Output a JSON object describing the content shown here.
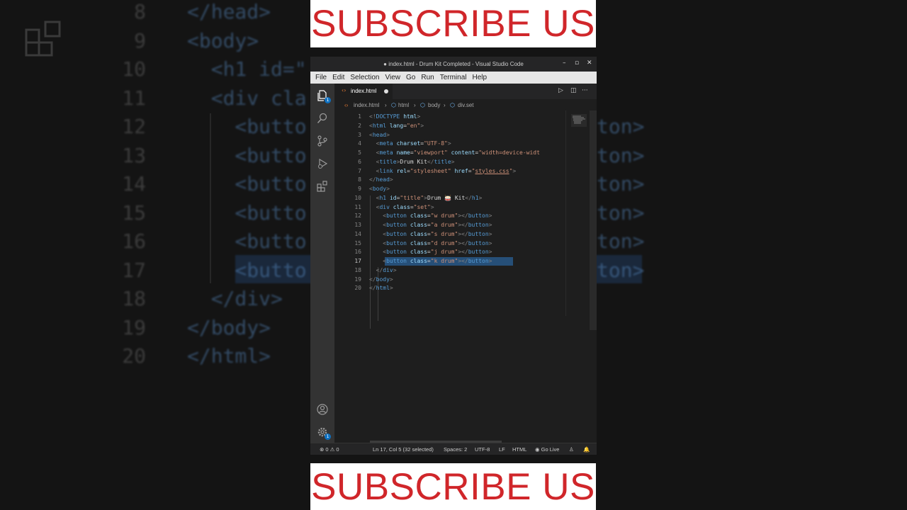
{
  "banner": {
    "top": "SUBSCRIBE US",
    "bottom": "SUBSCRIBE US",
    "text_color": "#d0262a",
    "bg_color": "#ffffff"
  },
  "window": {
    "title": "● index.html - Drum Kit Completed - Visual Studio Code",
    "controls": {
      "minimize": "–",
      "maximize": "▫",
      "close": "✕"
    }
  },
  "menu": [
    "File",
    "Edit",
    "Selection",
    "View",
    "Go",
    "Run",
    "Terminal",
    "Help"
  ],
  "activity_bar": {
    "icons": [
      "explorer-icon",
      "search-icon",
      "source-control-icon",
      "run-debug-icon",
      "extensions-icon",
      "account-icon",
      "settings-gear-icon"
    ],
    "explorer_badge": "1",
    "settings_badge": "1"
  },
  "tab": {
    "label": "index.html",
    "icon": "‹›",
    "modified": true
  },
  "tab_tools": {
    "run": "▷",
    "split": "◫",
    "more": "···"
  },
  "breadcrumb": [
    "index.html",
    "html",
    "body",
    "div.set"
  ],
  "editor": {
    "current_line": 17,
    "lines": [
      {
        "n": "1",
        "html": "<span class='pn'>&lt;!</span><span class='tg'>DOCTYPE</span> <span class='at'>html</span><span class='pn'>&gt;</span>"
      },
      {
        "n": "2",
        "html": "<span class='pn'>&lt;</span><span class='tg'>html</span> <span class='at'>lang</span>=<span class='st'>\"en\"</span><span class='pn'>&gt;</span>"
      },
      {
        "n": "3",
        "html": "<span class='pn'>&lt;</span><span class='tg'>head</span><span class='pn'>&gt;</span>"
      },
      {
        "n": "4",
        "html": "  <span class='pn'>&lt;</span><span class='tg'>meta</span> <span class='at'>charset</span>=<span class='st'>\"UTF-8\"</span><span class='pn'>&gt;</span>"
      },
      {
        "n": "5",
        "html": "  <span class='pn'>&lt;</span><span class='tg'>meta</span> <span class='at'>name</span>=<span class='st'>\"viewport\"</span> <span class='at'>content</span>=<span class='st'>\"width=device-widt</span>"
      },
      {
        "n": "6",
        "html": "  <span class='pn'>&lt;</span><span class='tg'>title</span><span class='pn'>&gt;</span>Drum Kit<span class='pn'>&lt;/</span><span class='tg'>title</span><span class='pn'>&gt;</span>"
      },
      {
        "n": "7",
        "html": "  <span class='pn'>&lt;</span><span class='tg'>link</span> <span class='at'>rel</span>=<span class='st'>\"stylesheet\"</span> <span class='at'>href</span>=<span class='st'>\"</span><span class='lk'>styles.css</span><span class='st'>\"</span><span class='pn'>&gt;</span>"
      },
      {
        "n": "8",
        "html": "<span class='pn'>&lt;/</span><span class='tg'>head</span><span class='pn'>&gt;</span>"
      },
      {
        "n": "9",
        "html": "<span class='pn'>&lt;</span><span class='tg'>body</span><span class='pn'>&gt;</span>"
      },
      {
        "n": "10",
        "html": "  <span class='pn'>&lt;</span><span class='tg'>h1</span> <span class='at'>id</span>=<span class='st'>\"title\"</span><span class='pn'>&gt;</span>Drum 🥁 Kit<span class='pn'>&lt;/</span><span class='tg'>h1</span><span class='pn'>&gt;</span>"
      },
      {
        "n": "11",
        "html": "  <span class='pn'>&lt;</span><span class='tg'>div</span> <span class='at'>class</span>=<span class='st'>\"set\"</span><span class='pn'>&gt;</span>"
      },
      {
        "n": "12",
        "html": "    <span class='pn'>&lt;</span><span class='tg'>button</span> <span class='at'>class</span>=<span class='st'>\"w drum\"</span><span class='pn'>&gt;&lt;/</span><span class='tg'>button</span><span class='pn'>&gt;</span>"
      },
      {
        "n": "13",
        "html": "    <span class='pn'>&lt;</span><span class='tg'>button</span> <span class='at'>class</span>=<span class='st'>\"a drum\"</span><span class='pn'>&gt;&lt;/</span><span class='tg'>button</span><span class='pn'>&gt;</span>"
      },
      {
        "n": "14",
        "html": "    <span class='pn'>&lt;</span><span class='tg'>button</span> <span class='at'>class</span>=<span class='st'>\"s drum\"</span><span class='pn'>&gt;&lt;/</span><span class='tg'>button</span><span class='pn'>&gt;</span>"
      },
      {
        "n": "15",
        "html": "    <span class='pn'>&lt;</span><span class='tg'>button</span> <span class='at'>class</span>=<span class='st'>\"d drum\"</span><span class='pn'>&gt;&lt;/</span><span class='tg'>button</span><span class='pn'>&gt;</span>"
      },
      {
        "n": "16",
        "html": "    <span class='pn'>&lt;</span><span class='tg'>button</span> <span class='at'>class</span>=<span class='st'>\"j drum\"</span><span class='pn'>&gt;&lt;/</span><span class='tg'>button</span><span class='pn'>&gt;</span>"
      },
      {
        "n": "17",
        "html": "    <span class='pn'>&lt;</span><span class='tg'>button</span> <span class='at'>class</span>=<span class='st'>\"k drum\"</span><span class='pn'>&gt;&lt;/</span><span class='tg'>button</span><span class='pn'>&gt;</span>"
      },
      {
        "n": "18",
        "html": "  <span class='pn'>&lt;/</span><span class='tg'>div</span><span class='pn'>&gt;</span>"
      },
      {
        "n": "19",
        "html": "<span class='pn'>&lt;/</span><span class='tg'>body</span><span class='pn'>&gt;</span>"
      },
      {
        "n": "20",
        "html": "<span class='pn'>&lt;/</span><span class='tg'>html</span><span class='pn'>&gt;</span>"
      }
    ],
    "bg_lines": [
      {
        "n": "8",
        "text": "</head>"
      },
      {
        "n": "9",
        "text": "<body>"
      },
      {
        "n": "10",
        "text": "  <h1 id=\""
      },
      {
        "n": "11",
        "text": "  <div cla"
      },
      {
        "n": "12",
        "text": "    <butto"
      },
      {
        "n": "13",
        "text": "    <butto"
      },
      {
        "n": "14",
        "text": "    <butto"
      },
      {
        "n": "15",
        "text": "    <butto"
      },
      {
        "n": "16",
        "text": "    <butto"
      },
      {
        "n": "17",
        "text": "    <butto"
      },
      {
        "n": "18",
        "text": "  </div>"
      },
      {
        "n": "19",
        "text": "</body>"
      },
      {
        "n": "20",
        "text": "</html>"
      }
    ],
    "bg_right": [
      "ton>",
      "ton>",
      "ton>",
      "ton>",
      "ton>",
      "ton>"
    ]
  },
  "status_bar": {
    "problems": "⊗ 0 ⚠ 0",
    "position": "Ln 17, Col 5 (32 selected)",
    "spaces": "Spaces: 2",
    "encoding": "UTF-8",
    "eol": "LF",
    "language": "HTML",
    "go_live": "◉ Go Live",
    "feedback": "♙",
    "notifications": "🔔"
  },
  "colors": {
    "activity_bar": "#333333",
    "editor_bg": "#1e1e1e",
    "selection": "#264f78",
    "tag": "#569cd6",
    "attr": "#9cdcfe",
    "string": "#ce9178"
  }
}
